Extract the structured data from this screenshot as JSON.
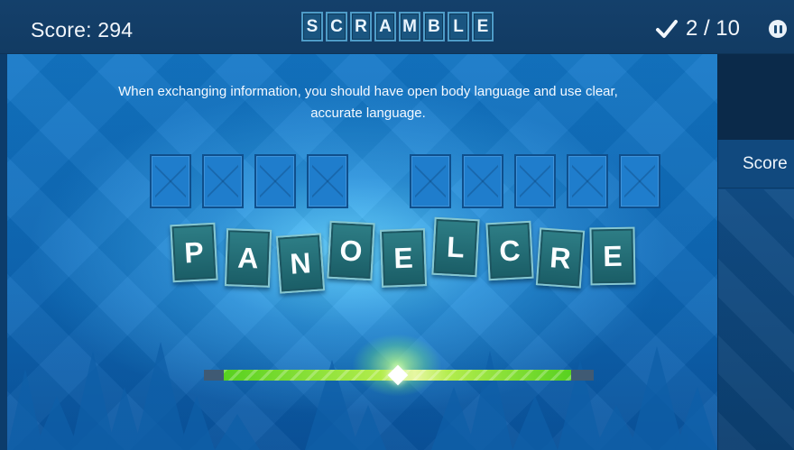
{
  "header": {
    "score_label": "Score: 294",
    "title_letters": [
      "S",
      "C",
      "R",
      "A",
      "M",
      "B",
      "L",
      "E"
    ],
    "progress": "2 / 10",
    "check_icon": "checkmark-icon",
    "pause_icon": "pause-icon"
  },
  "question": {
    "text": "When exchanging information, you should have open body language and use clear, accurate language."
  },
  "answer": {
    "word_lengths": [
      4,
      5
    ]
  },
  "scrambled_letters": [
    "P",
    "A",
    "N",
    "O",
    "E",
    "L",
    "C",
    "R",
    "E"
  ],
  "side_panel": {
    "title": "Score"
  },
  "colors": {
    "accent_green": "#57d11f",
    "tile": "#1a5d66",
    "background": "#0d68b7"
  }
}
